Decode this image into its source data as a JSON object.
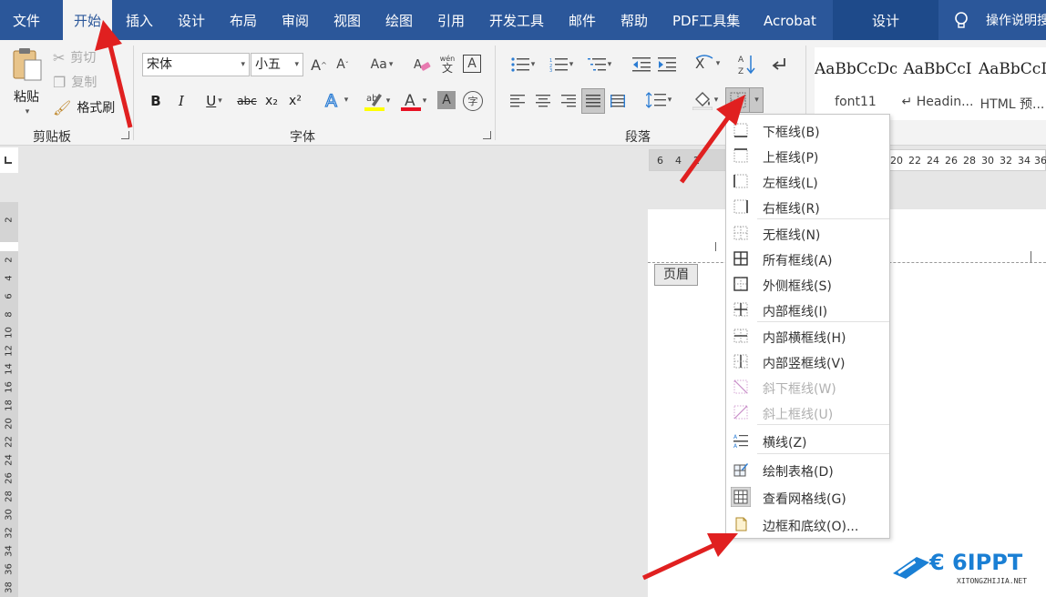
{
  "tabs": [
    {
      "label": "文件"
    },
    {
      "label": "开始"
    },
    {
      "label": "插入"
    },
    {
      "label": "设计"
    },
    {
      "label": "布局"
    },
    {
      "label": "审阅"
    },
    {
      "label": "视图"
    },
    {
      "label": "绘图"
    },
    {
      "label": "引用"
    },
    {
      "label": "开发工具"
    },
    {
      "label": "邮件"
    },
    {
      "label": "帮助"
    },
    {
      "label": "PDF工具集"
    },
    {
      "label": "Acrobat"
    }
  ],
  "context_tab": "设计",
  "tell_me": "操作说明搜",
  "clipboard": {
    "paste_label": "粘贴",
    "cut_label": "剪切",
    "copy_label": "复制",
    "format_painter_label": "格式刷",
    "group_label": "剪贴板"
  },
  "font": {
    "font_name": "宋体",
    "font_size": "小五",
    "group_label": "字体",
    "bold": "B",
    "italic": "I",
    "underline": "U",
    "strike": "abc",
    "subscript": "x₂",
    "superscript": "x²",
    "change_case": "Aa",
    "grow": "A",
    "shrink": "A",
    "pinyin_top": "wén",
    "pinyin_char": "文",
    "char_border": "A",
    "font_color": "A",
    "char_shading": "A",
    "enclose": "字"
  },
  "paragraph": {
    "group_label": "段落"
  },
  "styles": [
    {
      "sample": "AaBbCcDc",
      "name": "font11"
    },
    {
      "sample": "AaBbCcI",
      "name": "↵ Headin..."
    },
    {
      "sample": "AaBbCcD",
      "name": "HTML 预..."
    }
  ],
  "ruler": {
    "h_ticks": [
      "6",
      "4",
      "2",
      "20",
      "22",
      "24",
      "26",
      "28",
      "30",
      "32",
      "34",
      "36"
    ],
    "v_ticks": [
      "2",
      "2",
      "4",
      "6",
      "8",
      "10",
      "12",
      "14",
      "16",
      "18",
      "20",
      "22",
      "24",
      "26",
      "28",
      "30",
      "32",
      "34",
      "36",
      "38"
    ]
  },
  "document": {
    "header_tag": "页眉"
  },
  "border_menu": {
    "items": [
      {
        "label": "下框线(B)",
        "icon": "bottom-border-icon"
      },
      {
        "label": "上框线(P)",
        "icon": "top-border-icon"
      },
      {
        "label": "左框线(L)",
        "icon": "left-border-icon"
      },
      {
        "label": "右框线(R)",
        "icon": "right-border-icon"
      },
      {
        "label": "无框线(N)",
        "icon": "no-border-icon"
      },
      {
        "label": "所有框线(A)",
        "icon": "all-borders-icon"
      },
      {
        "label": "外侧框线(S)",
        "icon": "outside-borders-icon"
      },
      {
        "label": "内部框线(I)",
        "icon": "inside-borders-icon"
      },
      {
        "label": "内部横框线(H)",
        "icon": "inside-horizontal-border-icon"
      },
      {
        "label": "内部竖框线(V)",
        "icon": "inside-vertical-border-icon"
      },
      {
        "label": "斜下框线(W)",
        "icon": "diagonal-down-border-icon"
      },
      {
        "label": "斜上框线(U)",
        "icon": "diagonal-up-border-icon"
      },
      {
        "label": "横线(Z)",
        "icon": "horizontal-line-icon"
      },
      {
        "label": "绘制表格(D)",
        "icon": "draw-table-icon"
      },
      {
        "label": "查看网格线(G)",
        "icon": "view-gridlines-icon"
      },
      {
        "label": "边框和底纹(O)...",
        "icon": "borders-shading-icon"
      }
    ]
  },
  "watermark": {
    "main": "€ 6IPPT",
    "sub": "XITONGZHIJIA.NET"
  },
  "colors": {
    "ribbon_blue": "#2b579a",
    "arrow_red": "#e02020",
    "font_color_bar": "#e81123",
    "highlight_bar": "#ffff00"
  }
}
